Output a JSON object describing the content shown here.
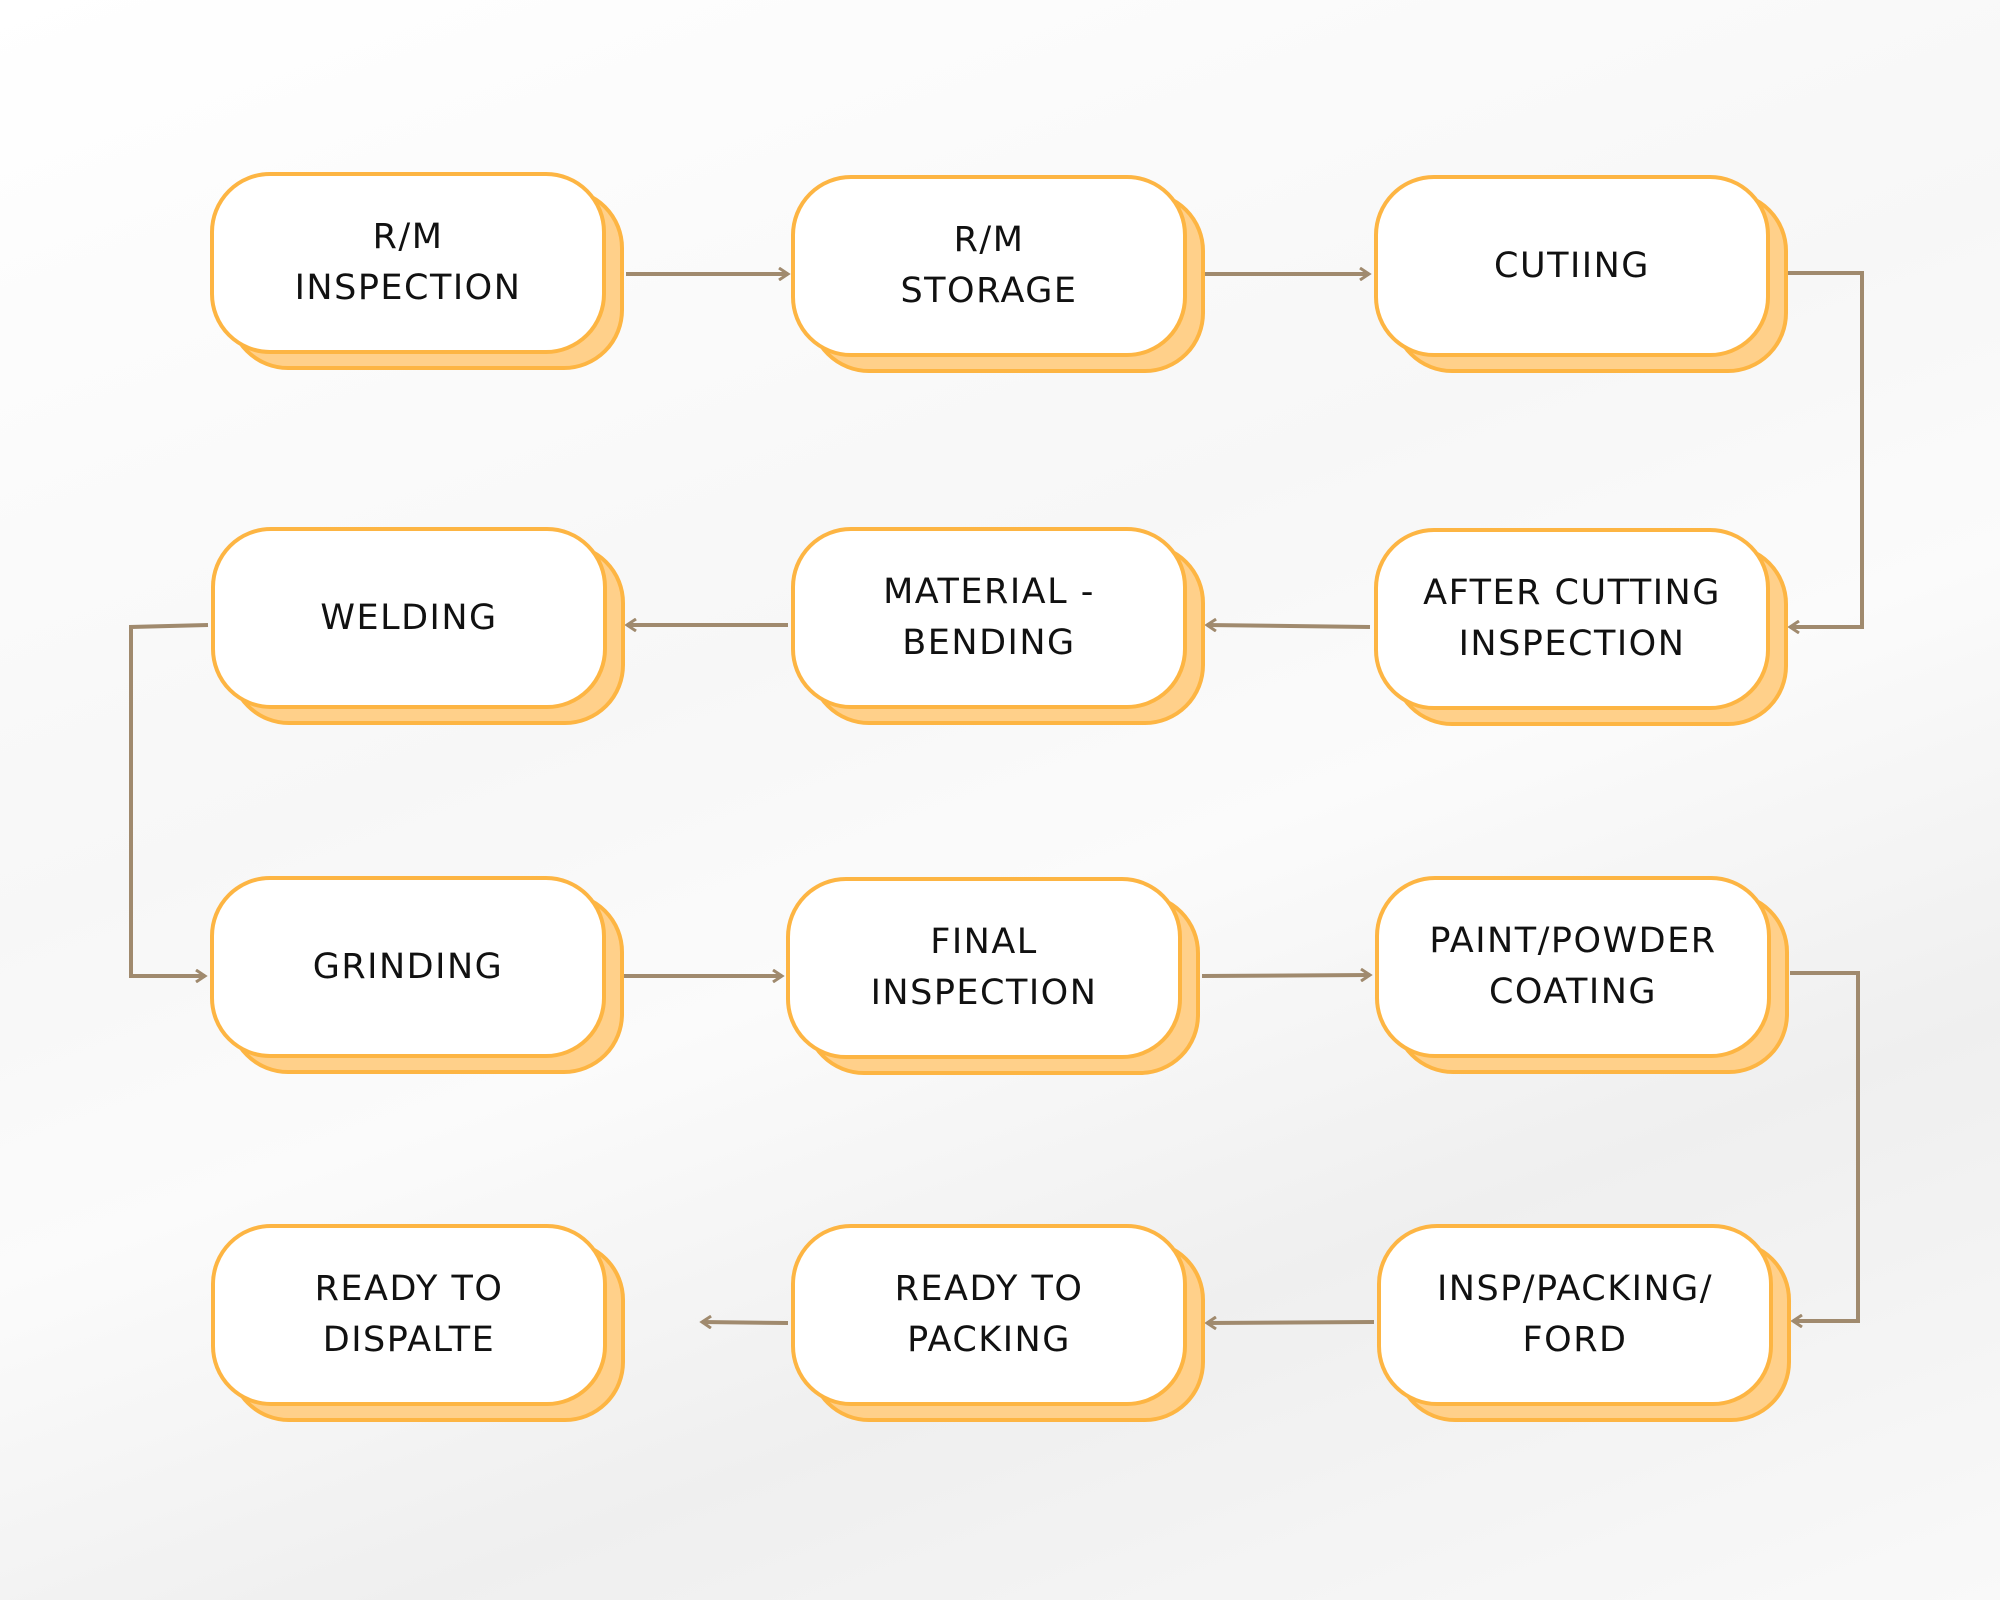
{
  "colors": {
    "box_border": "#fdb543",
    "box_shadow": "#ffd08a",
    "box_fill": "#ffffff",
    "connector": "#a08a6e",
    "text": "#111111"
  },
  "steps": [
    {
      "label": "R/M\nINSPECTION"
    },
    {
      "label": "R/M\nSTORAGE"
    },
    {
      "label": "CUTIING"
    },
    {
      "label": "AFTER CUTTING\nINSPECTION"
    },
    {
      "label": "MATERIAL -\nBENDING"
    },
    {
      "label": "WELDING"
    },
    {
      "label": "GRINDING"
    },
    {
      "label": "FINAL\nINSPECTION"
    },
    {
      "label": "PAINT/POWDER\nCOATING"
    },
    {
      "label": "INSP/PACKING/\nFORD"
    },
    {
      "label": "READY TO\nPACKING"
    },
    {
      "label": "READY TO\nDISPALTE"
    }
  ]
}
